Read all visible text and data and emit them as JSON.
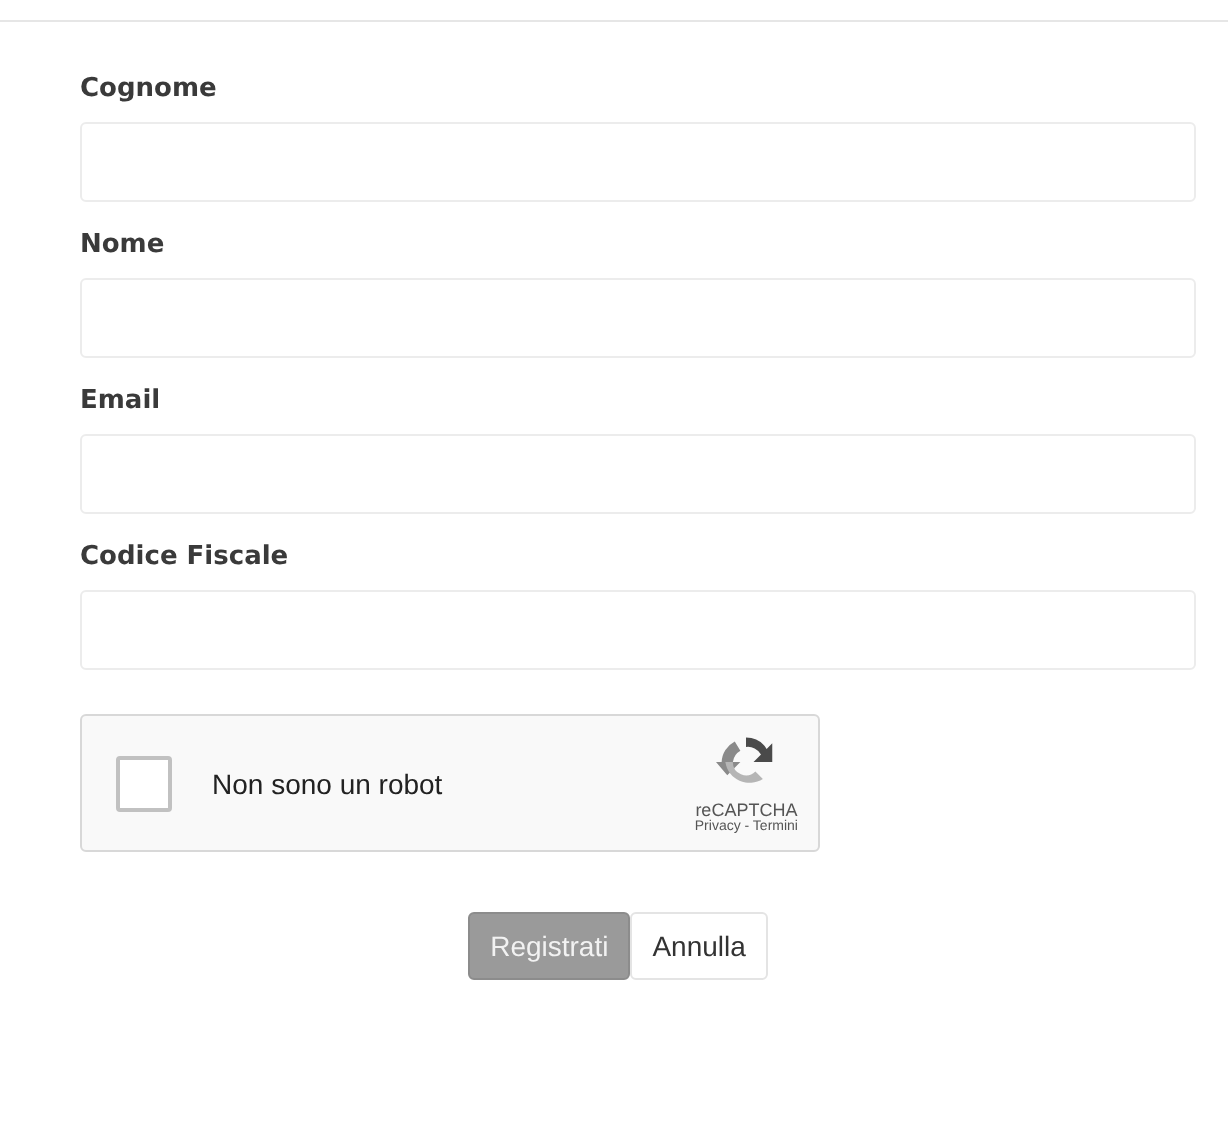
{
  "fields": [
    {
      "label": "Cognome"
    },
    {
      "label": "Nome"
    },
    {
      "label": "Email"
    },
    {
      "label": "Codice Fiscale"
    }
  ],
  "captcha": {
    "label": "Non sono un robot",
    "checked": false,
    "brand": "reCAPTCHA",
    "links": "Privacy - Termini"
  },
  "buttons": [
    {
      "label": "Registrati",
      "kind": "primary"
    },
    {
      "label": "Annulla",
      "kind": "default"
    }
  ]
}
